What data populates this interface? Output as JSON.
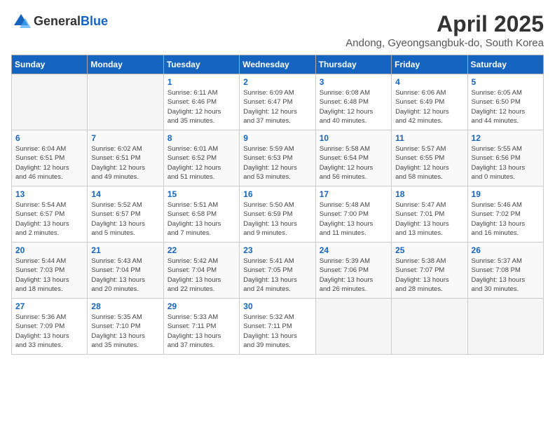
{
  "header": {
    "logo_general": "General",
    "logo_blue": "Blue",
    "month_title": "April 2025",
    "location": "Andong, Gyeongsangbuk-do, South Korea"
  },
  "days_of_week": [
    "Sunday",
    "Monday",
    "Tuesday",
    "Wednesday",
    "Thursday",
    "Friday",
    "Saturday"
  ],
  "weeks": [
    [
      {
        "day": "",
        "info": ""
      },
      {
        "day": "",
        "info": ""
      },
      {
        "day": "1",
        "info": "Sunrise: 6:11 AM\nSunset: 6:46 PM\nDaylight: 12 hours\nand 35 minutes."
      },
      {
        "day": "2",
        "info": "Sunrise: 6:09 AM\nSunset: 6:47 PM\nDaylight: 12 hours\nand 37 minutes."
      },
      {
        "day": "3",
        "info": "Sunrise: 6:08 AM\nSunset: 6:48 PM\nDaylight: 12 hours\nand 40 minutes."
      },
      {
        "day": "4",
        "info": "Sunrise: 6:06 AM\nSunset: 6:49 PM\nDaylight: 12 hours\nand 42 minutes."
      },
      {
        "day": "5",
        "info": "Sunrise: 6:05 AM\nSunset: 6:50 PM\nDaylight: 12 hours\nand 44 minutes."
      }
    ],
    [
      {
        "day": "6",
        "info": "Sunrise: 6:04 AM\nSunset: 6:51 PM\nDaylight: 12 hours\nand 46 minutes."
      },
      {
        "day": "7",
        "info": "Sunrise: 6:02 AM\nSunset: 6:51 PM\nDaylight: 12 hours\nand 49 minutes."
      },
      {
        "day": "8",
        "info": "Sunrise: 6:01 AM\nSunset: 6:52 PM\nDaylight: 12 hours\nand 51 minutes."
      },
      {
        "day": "9",
        "info": "Sunrise: 5:59 AM\nSunset: 6:53 PM\nDaylight: 12 hours\nand 53 minutes."
      },
      {
        "day": "10",
        "info": "Sunrise: 5:58 AM\nSunset: 6:54 PM\nDaylight: 12 hours\nand 56 minutes."
      },
      {
        "day": "11",
        "info": "Sunrise: 5:57 AM\nSunset: 6:55 PM\nDaylight: 12 hours\nand 58 minutes."
      },
      {
        "day": "12",
        "info": "Sunrise: 5:55 AM\nSunset: 6:56 PM\nDaylight: 13 hours\nand 0 minutes."
      }
    ],
    [
      {
        "day": "13",
        "info": "Sunrise: 5:54 AM\nSunset: 6:57 PM\nDaylight: 13 hours\nand 2 minutes."
      },
      {
        "day": "14",
        "info": "Sunrise: 5:52 AM\nSunset: 6:57 PM\nDaylight: 13 hours\nand 5 minutes."
      },
      {
        "day": "15",
        "info": "Sunrise: 5:51 AM\nSunset: 6:58 PM\nDaylight: 13 hours\nand 7 minutes."
      },
      {
        "day": "16",
        "info": "Sunrise: 5:50 AM\nSunset: 6:59 PM\nDaylight: 13 hours\nand 9 minutes."
      },
      {
        "day": "17",
        "info": "Sunrise: 5:48 AM\nSunset: 7:00 PM\nDaylight: 13 hours\nand 11 minutes."
      },
      {
        "day": "18",
        "info": "Sunrise: 5:47 AM\nSunset: 7:01 PM\nDaylight: 13 hours\nand 13 minutes."
      },
      {
        "day": "19",
        "info": "Sunrise: 5:46 AM\nSunset: 7:02 PM\nDaylight: 13 hours\nand 16 minutes."
      }
    ],
    [
      {
        "day": "20",
        "info": "Sunrise: 5:44 AM\nSunset: 7:03 PM\nDaylight: 13 hours\nand 18 minutes."
      },
      {
        "day": "21",
        "info": "Sunrise: 5:43 AM\nSunset: 7:04 PM\nDaylight: 13 hours\nand 20 minutes."
      },
      {
        "day": "22",
        "info": "Sunrise: 5:42 AM\nSunset: 7:04 PM\nDaylight: 13 hours\nand 22 minutes."
      },
      {
        "day": "23",
        "info": "Sunrise: 5:41 AM\nSunset: 7:05 PM\nDaylight: 13 hours\nand 24 minutes."
      },
      {
        "day": "24",
        "info": "Sunrise: 5:39 AM\nSunset: 7:06 PM\nDaylight: 13 hours\nand 26 minutes."
      },
      {
        "day": "25",
        "info": "Sunrise: 5:38 AM\nSunset: 7:07 PM\nDaylight: 13 hours\nand 28 minutes."
      },
      {
        "day": "26",
        "info": "Sunrise: 5:37 AM\nSunset: 7:08 PM\nDaylight: 13 hours\nand 30 minutes."
      }
    ],
    [
      {
        "day": "27",
        "info": "Sunrise: 5:36 AM\nSunset: 7:09 PM\nDaylight: 13 hours\nand 33 minutes."
      },
      {
        "day": "28",
        "info": "Sunrise: 5:35 AM\nSunset: 7:10 PM\nDaylight: 13 hours\nand 35 minutes."
      },
      {
        "day": "29",
        "info": "Sunrise: 5:33 AM\nSunset: 7:11 PM\nDaylight: 13 hours\nand 37 minutes."
      },
      {
        "day": "30",
        "info": "Sunrise: 5:32 AM\nSunset: 7:11 PM\nDaylight: 13 hours\nand 39 minutes."
      },
      {
        "day": "",
        "info": ""
      },
      {
        "day": "",
        "info": ""
      },
      {
        "day": "",
        "info": ""
      }
    ]
  ]
}
